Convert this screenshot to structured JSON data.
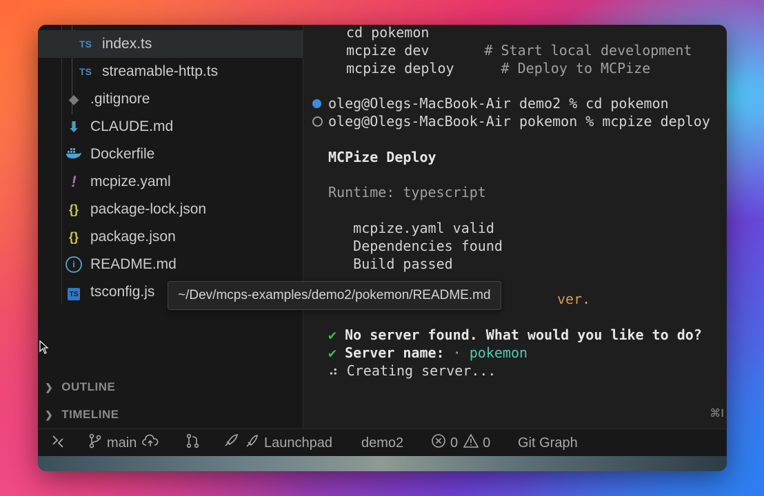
{
  "explorer": {
    "files": [
      {
        "label": "index.ts",
        "icon": "typescript-icon",
        "icon_text": "TS",
        "selected": true
      },
      {
        "label": "streamable-http.ts",
        "icon": "typescript-icon",
        "icon_text": "TS"
      },
      {
        "label": ".gitignore",
        "icon": "git-icon",
        "icon_text": "◆"
      },
      {
        "label": "CLAUDE.md",
        "icon": "markdown-icon",
        "icon_text": "⬇"
      },
      {
        "label": "Dockerfile",
        "icon": "docker-icon",
        "icon_text": "🐳"
      },
      {
        "label": "mcpize.yaml",
        "icon": "yaml-icon",
        "icon_text": "!"
      },
      {
        "label": "package-lock.json",
        "icon": "json-icon",
        "icon_text": "{}"
      },
      {
        "label": "package.json",
        "icon": "json-icon",
        "icon_text": "{}"
      },
      {
        "label": "README.md",
        "icon": "info-icon",
        "icon_text": "i"
      },
      {
        "label": "tsconfig.js",
        "icon": "tsconfig-icon",
        "icon_text": "TS"
      }
    ],
    "sections": {
      "outline": "OUTLINE",
      "timeline": "TIMELINE"
    },
    "tooltip": "~/Dev/mcps-examples/demo2/pokemon/README.md"
  },
  "terminal": {
    "help_lines": [
      {
        "cmd": "cd pokemon",
        "comment": ""
      },
      {
        "cmd": "mcpize dev",
        "comment": "# Start local development"
      },
      {
        "cmd": "mcpize deploy",
        "comment": "# Deploy to MCPize"
      }
    ],
    "prompt1": "oleg@Olegs-MacBook-Air demo2 % cd pokemon",
    "prompt2": "oleg@Olegs-MacBook-Air pokemon % mcpize deploy",
    "title": "MCPize Deploy",
    "runtime": "Runtime: typescript",
    "checks": [
      "✔ mcpize.yaml valid",
      "✔ Dependencies found",
      "✔ Build passed"
    ],
    "partial_hidden": "ver.",
    "q1_check": "✔",
    "q1": "No server found. What would you like to do?",
    "q2_check": "✔",
    "q2_label": "Server name:",
    "q2_sep": "·",
    "q2_value": "pokemon",
    "spinner": "⠴",
    "creating": "Creating server...",
    "shortcut_hint": "⌘I"
  },
  "statusbar": {
    "remote_icon": "remote-icon",
    "branch": "main",
    "launchpad": "Launchpad",
    "folder": "demo2",
    "errors": "0",
    "warnings": "0",
    "git_graph": "Git Graph"
  },
  "colors": {
    "editor_bg": "#1e1e1e",
    "sidebar_bg": "#181818",
    "check_green": "#3fb950",
    "value_cyan": "#4ec9b0",
    "dot_blue": "#3b8fd6"
  }
}
